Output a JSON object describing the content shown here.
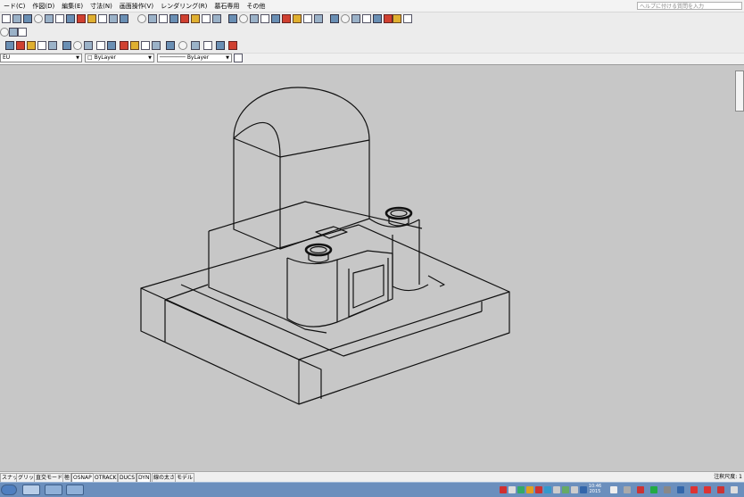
{
  "menu": [
    "ード(C)",
    "作図(D)",
    "編集(E)",
    "寸法(N)",
    "画面操作(V)",
    "レンダリング(R)",
    "墓石専用",
    "その他"
  ],
  "help_placeholder": "ヘルプに付ける質問を入力",
  "properties": {
    "layer": "EU",
    "color": "ByLayer",
    "linetype": "ByLayer"
  },
  "status": {
    "toggles": [
      "スナップ",
      "グリッド",
      "直交モード",
      "極",
      "OSNAP",
      "OTRACK",
      "DUCS",
      "DYN",
      "線の太さ",
      "モデル"
    ],
    "annotation_scale": "注釈尺度: 1"
  },
  "taskbar": {
    "clock": "10:46\n2015"
  },
  "icons": {
    "toolbar": "cad-tool-icons",
    "viewcube": "viewcube-icon",
    "taskbar": [
      "start-button-icon",
      "skype-icon",
      "chrome-icon",
      "cad-app-icon"
    ]
  }
}
